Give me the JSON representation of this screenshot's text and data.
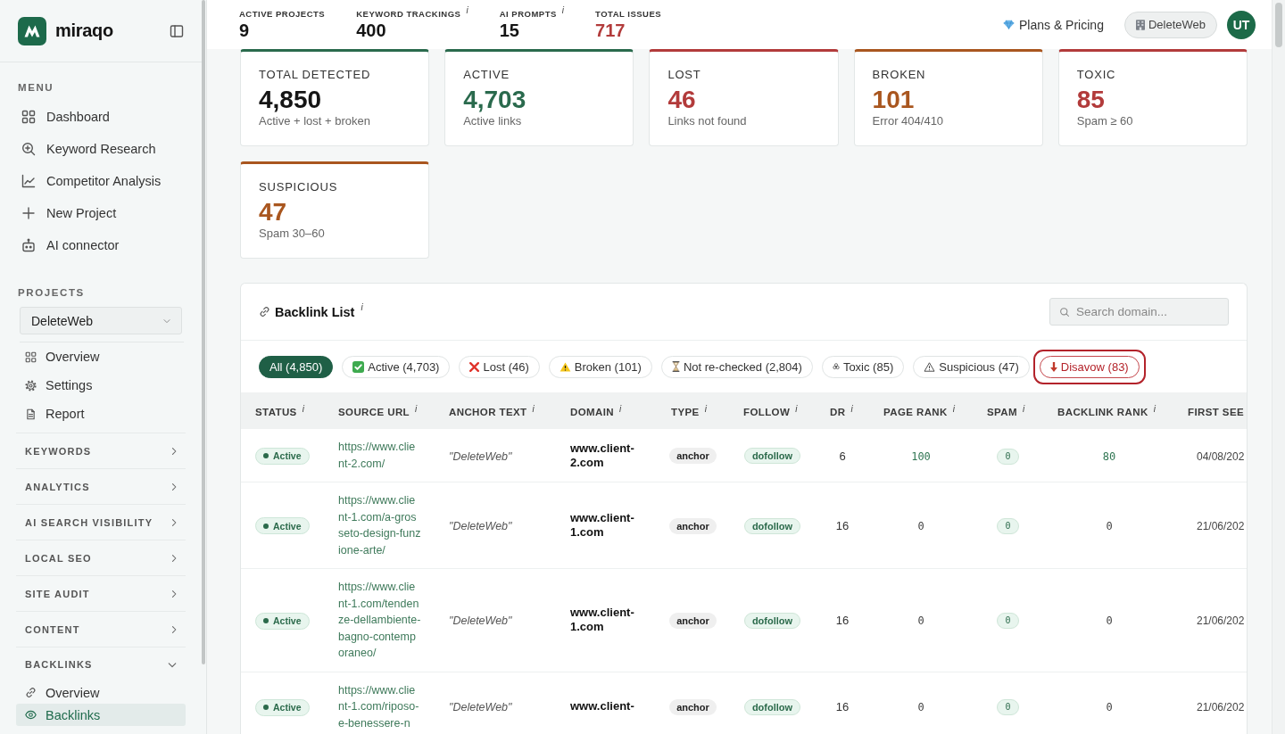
{
  "sidebar": {
    "brand": "miraqo",
    "menu_label": "MENU",
    "menu": [
      {
        "label": "Dashboard"
      },
      {
        "label": "Keyword Research"
      },
      {
        "label": "Competitor Analysis"
      },
      {
        "label": "New Project"
      },
      {
        "label": "AI connector"
      }
    ],
    "projects_label": "PROJECTS",
    "project_select": {
      "value": "DeleteWeb"
    },
    "project_links": [
      {
        "label": "Overview"
      },
      {
        "label": "Settings"
      },
      {
        "label": "Report"
      }
    ],
    "sections": [
      {
        "label": "KEYWORDS",
        "expanded": false
      },
      {
        "label": "ANALYTICS",
        "expanded": false
      },
      {
        "label": "AI SEARCH VISIBILITY",
        "expanded": false
      },
      {
        "label": "LOCAL SEO",
        "expanded": false
      },
      {
        "label": "SITE AUDIT",
        "expanded": false
      },
      {
        "label": "CONTENT",
        "expanded": false
      },
      {
        "label": "BACKLINKS",
        "expanded": true,
        "children": [
          {
            "label": "Overview",
            "selected": false
          },
          {
            "label": "Backlinks",
            "selected": true
          }
        ]
      }
    ]
  },
  "top_bar": {
    "stats": [
      {
        "label": "ACTIVE PROJECTS",
        "value": "9",
        "alert": false
      },
      {
        "label": "KEYWORD TRACKINGS",
        "info": "i",
        "value": "400",
        "alert": false
      },
      {
        "label": "AI PROMPTS",
        "info": "i",
        "value": "15",
        "alert": false
      },
      {
        "label": "TOTAL ISSUES",
        "value": "717",
        "alert": true
      }
    ],
    "plans_link": "Plans & Pricing",
    "project_button": "DeleteWeb",
    "avatar": "UT"
  },
  "cards": [
    {
      "label": "TOTAL DETECTED",
      "value": "4,850",
      "caption": "Active + lost + broken",
      "color": "#2a6a4d",
      "value_colored": false
    },
    {
      "label": "ACTIVE",
      "value": "4,703",
      "caption": "Active links",
      "color": "#2a6a4d",
      "value_colored": true
    },
    {
      "label": "LOST",
      "value": "46",
      "caption": "Links not found",
      "color": "#b23b3b",
      "value_colored": true
    },
    {
      "label": "BROKEN",
      "value": "101",
      "caption": "Error 404/410",
      "color": "#a9561f",
      "value_colored": true
    },
    {
      "label": "TOXIC",
      "value": "85",
      "caption": "Spam ≥ 60",
      "color": "#b23b3b",
      "value_colored": true
    },
    {
      "label": "SUSPICIOUS",
      "value": "47",
      "caption": "Spam 30–60",
      "color": "#a9561f",
      "value_colored": true
    }
  ],
  "backlink_list": {
    "title": "Backlink List",
    "info": "i",
    "search": {
      "placeholder": "Search domain..."
    },
    "filters": [
      {
        "label": "All (4,850)",
        "kind": "all",
        "selected": true,
        "focused": false
      },
      {
        "label": "Active (4,703)",
        "kind": "active",
        "selected": false,
        "focused": false
      },
      {
        "label": "Lost (46)",
        "kind": "lost",
        "selected": false,
        "focused": false
      },
      {
        "label": "Broken (101)",
        "kind": "broken",
        "selected": false,
        "focused": false
      },
      {
        "label": "Not re-checked (2,804)",
        "kind": "pending",
        "selected": false,
        "focused": false
      },
      {
        "label": "Toxic (85)",
        "kind": "toxic",
        "selected": false,
        "focused": false
      },
      {
        "label": "Suspicious (47)",
        "kind": "suspicious",
        "selected": false,
        "focused": false
      },
      {
        "label": "Disavow (83)",
        "kind": "disavow",
        "selected": false,
        "focused": true
      }
    ],
    "table": {
      "columns": [
        {
          "label": "STATUS",
          "info": "i"
        },
        {
          "label": "SOURCE URL",
          "info": "i"
        },
        {
          "label": "ANCHOR TEXT",
          "info": "i"
        },
        {
          "label": "DOMAIN",
          "info": "i"
        },
        {
          "label": "TYPE",
          "info": "i"
        },
        {
          "label": "FOLLOW",
          "info": "i"
        },
        {
          "label": "DR",
          "info": "i"
        },
        {
          "label": "PAGE RANK",
          "info": "i"
        },
        {
          "label": "SPAM",
          "info": "i"
        },
        {
          "label": "BACKLINK RANK",
          "info": "i"
        },
        {
          "label": "FIRST SEE"
        }
      ],
      "rows": [
        {
          "status": {
            "label": "Active",
            "kind": "active"
          },
          "source_url": "https://www.client-2.com/",
          "anchor_text": "\"DeleteWeb\"",
          "domain": "www.client-2.com",
          "type": "anchor",
          "follow": "dofollow",
          "dr": "6",
          "page_rank": {
            "value": "100",
            "highlighted": true
          },
          "spam": "0",
          "backlink_rank": {
            "value": "80",
            "highlighted": true
          },
          "first_seen": "04/08/202"
        },
        {
          "status": {
            "label": "Active",
            "kind": "active"
          },
          "source_url": "https://www.client-1.com/a-grosseto-design-funzione-arte/",
          "anchor_text": "\"DeleteWeb\"",
          "domain": "www.client-1.com",
          "type": "anchor",
          "follow": "dofollow",
          "dr": "16",
          "page_rank": {
            "value": "0",
            "highlighted": false
          },
          "spam": "0",
          "backlink_rank": {
            "value": "0",
            "highlighted": false
          },
          "first_seen": "21/06/202"
        },
        {
          "status": {
            "label": "Active",
            "kind": "active"
          },
          "source_url": "https://www.client-1.com/tendenze-dellambiente-bagno-contemporaneo/",
          "anchor_text": "\"DeleteWeb\"",
          "domain": "www.client-1.com",
          "type": "anchor",
          "follow": "dofollow",
          "dr": "16",
          "page_rank": {
            "value": "0",
            "highlighted": false
          },
          "spam": "0",
          "backlink_rank": {
            "value": "0",
            "highlighted": false
          },
          "first_seen": "21/06/202"
        },
        {
          "status": {
            "label": "Active",
            "kind": "active"
          },
          "source_url": "https://www.client-1.com/riposo-e-benessere-n",
          "anchor_text": "\"DeleteWeb\"",
          "domain": "www.client-",
          "type": "anchor",
          "follow": "dofollow",
          "dr": "16",
          "page_rank": {
            "value": "0",
            "highlighted": false
          },
          "spam": "0",
          "backlink_rank": {
            "value": "0",
            "highlighted": false
          },
          "first_seen": "21/06/202"
        }
      ]
    }
  }
}
